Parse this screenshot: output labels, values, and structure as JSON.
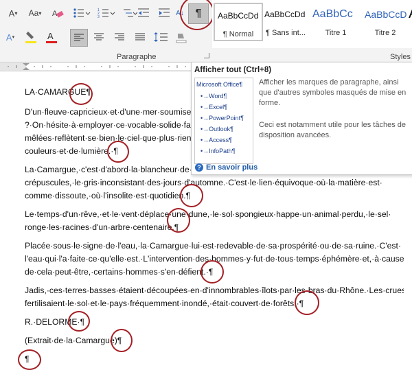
{
  "ribbon": {
    "group_paragraph_label": "Paragraphe",
    "group_styles_label": "Styles",
    "styles": [
      {
        "preview": "AaBbCcDd",
        "name": "¶ Normal"
      },
      {
        "preview": "AaBbCcDd",
        "name": "¶ Sans int..."
      },
      {
        "preview": "AaBbCc",
        "name": "Titre 1"
      },
      {
        "preview": "AaBbCcD",
        "name": "Titre 2"
      }
    ],
    "style_partial": "A",
    "show_all_glyph": "¶",
    "sort_glyph": "A↓",
    "font_size_glyph": "A",
    "font_color_glyph": "A",
    "colors": {
      "highlight": "#f7e61c",
      "font_color": "#e01b1b",
      "accent_circle": "#a31f24",
      "pressed": "#c5c5c5"
    }
  },
  "tooltip": {
    "title": "Afficher tout (Ctrl+8)",
    "preview_lines": [
      "Microsoft Office¶",
      "•→Word¶",
      "•→Excel¶",
      "•→PowerPoint¶",
      "•→Outlook¶",
      "•→Access¶",
      "•→InfoPath¶"
    ],
    "description_1": "Afficher les marques de paragraphe, ainsi que d'autres symboles masqués de mise en forme.",
    "description_2": "Ceci est notamment utile pour les tâches de disposition avancées.",
    "link": "En savoir plus"
  },
  "document": {
    "lines": [
      "LA·CAMARGUE¶",
      "D'un·fleuve·capricieux·et·d'une·mer·soumise",
      "?·On·hésite·à·employer·ce·vocable·solide·fac",
      "mêlées·reflètent·se·bien·le·ciel·que·plus·rien",
      "couleurs·et·de·lumière.·¶",
      "La·Camargue,·c'est·d'abord·la·blancheur·de·",
      "crépuscules,·le·gris·inconsistant·des·jours·d'automne.·C'est·le·lien·équivoque·où·la·matière·est·",
      "comme·dissoute,·où·l'insolite·est·quotidien.¶",
      "Le·temps·d'un·rêve,·et·le·vent·déplace·une·dune,·le·sol·spongieux·happe·un·animal·perdu,·le·sel·",
      "ronge·les·racines·d'un·arbre·centenaire.¶",
      "Placée·sous·le·signe·de·l'eau,·la·Camargue·lui·est·redevable·de·sa·prospérité·ou·de·sa·ruine.·C'est·",
      "l'eau·qui·l'a·faite·ce·qu'elle·est.·L'intervention·des·hommes·y·fut·de·tous·temps·éphémère·et,·à·cause·",
      "de·cela·peut-être,·certains·hommes·s'en·défient.·¶",
      "Jadis,·ces·terres·basses·étaient·découpées·en·d'innombrables·îlots·par·les·bras·du·Rhône.·Les·crues·",
      "fertilisaient·le·sol·et·le·pays·fréquemment·inondé,·était·couvert·de·forêts.·¶",
      "R.·DELORME·¶",
      "(Extrait·de·la·Camargue)¶",
      "¶"
    ]
  }
}
